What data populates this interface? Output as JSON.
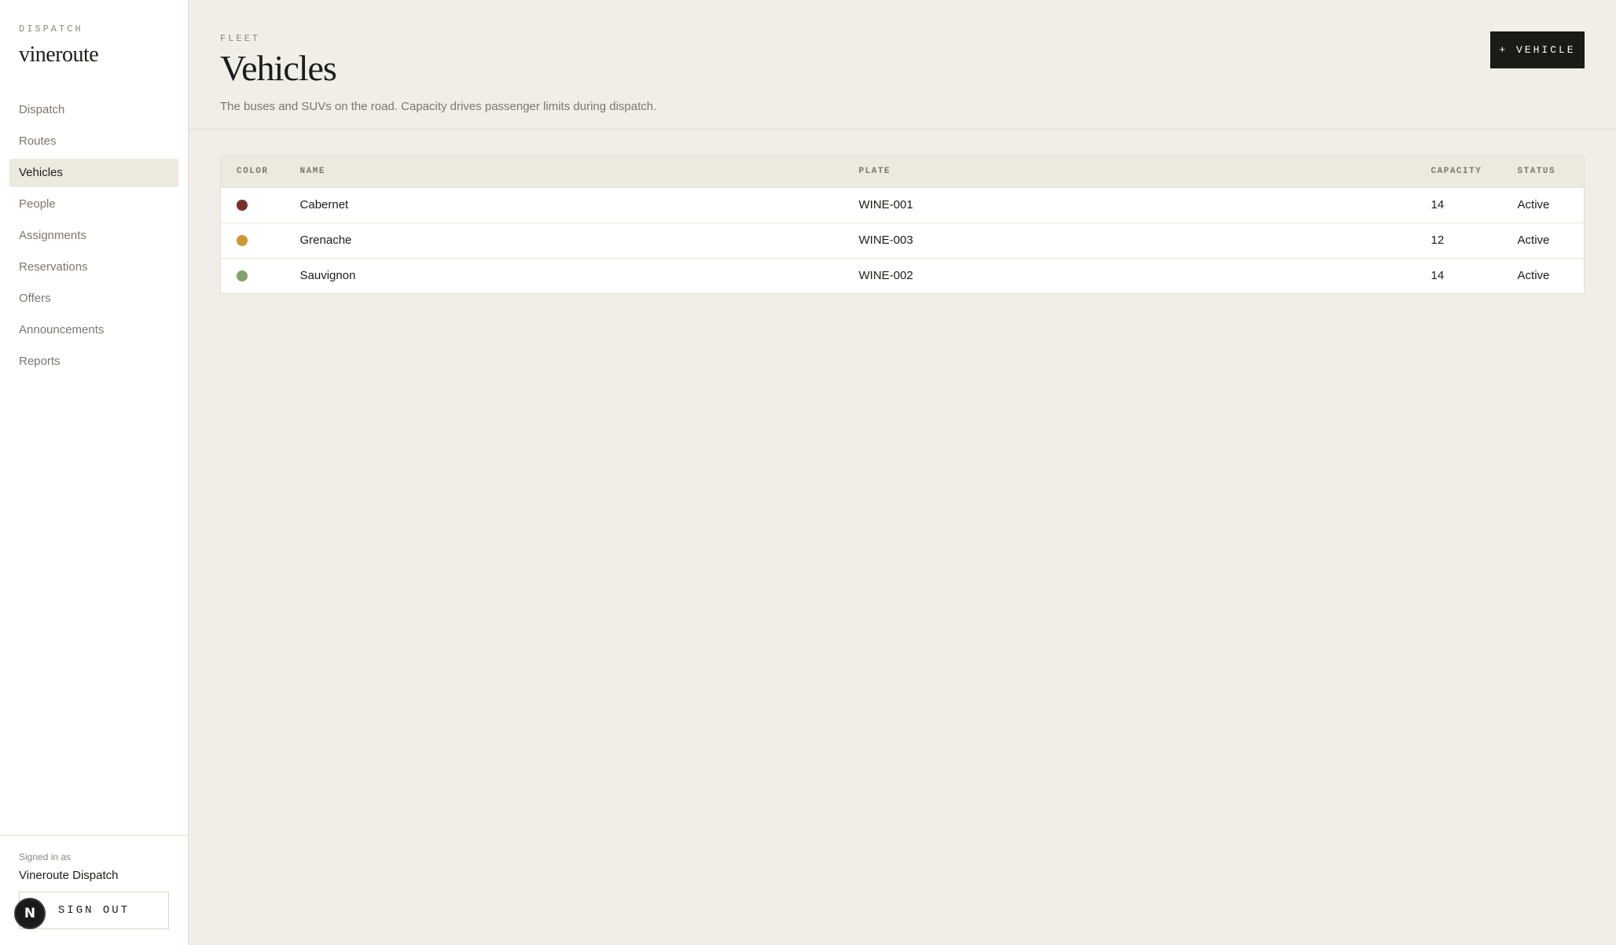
{
  "sidebar": {
    "eyebrow": "DISPATCH",
    "brand": "vineroute",
    "nav": [
      {
        "label": "Dispatch"
      },
      {
        "label": "Routes"
      },
      {
        "label": "Vehicles",
        "active": true
      },
      {
        "label": "People"
      },
      {
        "label": "Assignments"
      },
      {
        "label": "Reservations"
      },
      {
        "label": "Offers"
      },
      {
        "label": "Announcements"
      },
      {
        "label": "Reports"
      }
    ],
    "footer": {
      "signed_in_label": "Signed in as",
      "user": "Vineroute Dispatch",
      "sign_out_label": "SIGN OUT"
    },
    "fab_label": "N"
  },
  "header": {
    "eyebrow": "FLEET",
    "title": "Vehicles",
    "subtitle": "The buses and SUVs on the road. Capacity drives passenger limits during dispatch.",
    "add_button_label": "+ VEHICLE"
  },
  "table": {
    "columns": [
      "COLOR",
      "NAME",
      "PLATE",
      "CAPACITY",
      "STATUS"
    ],
    "rows": [
      {
        "color": "#7a2e2e",
        "name": "Cabernet",
        "plate": "WINE-001",
        "capacity": "14",
        "status": "Active"
      },
      {
        "color": "#c9982e",
        "name": "Grenache",
        "plate": "WINE-003",
        "capacity": "12",
        "status": "Active"
      },
      {
        "color": "#86a06a",
        "name": "Sauvignon",
        "plate": "WINE-002",
        "capacity": "14",
        "status": "Active"
      }
    ]
  }
}
